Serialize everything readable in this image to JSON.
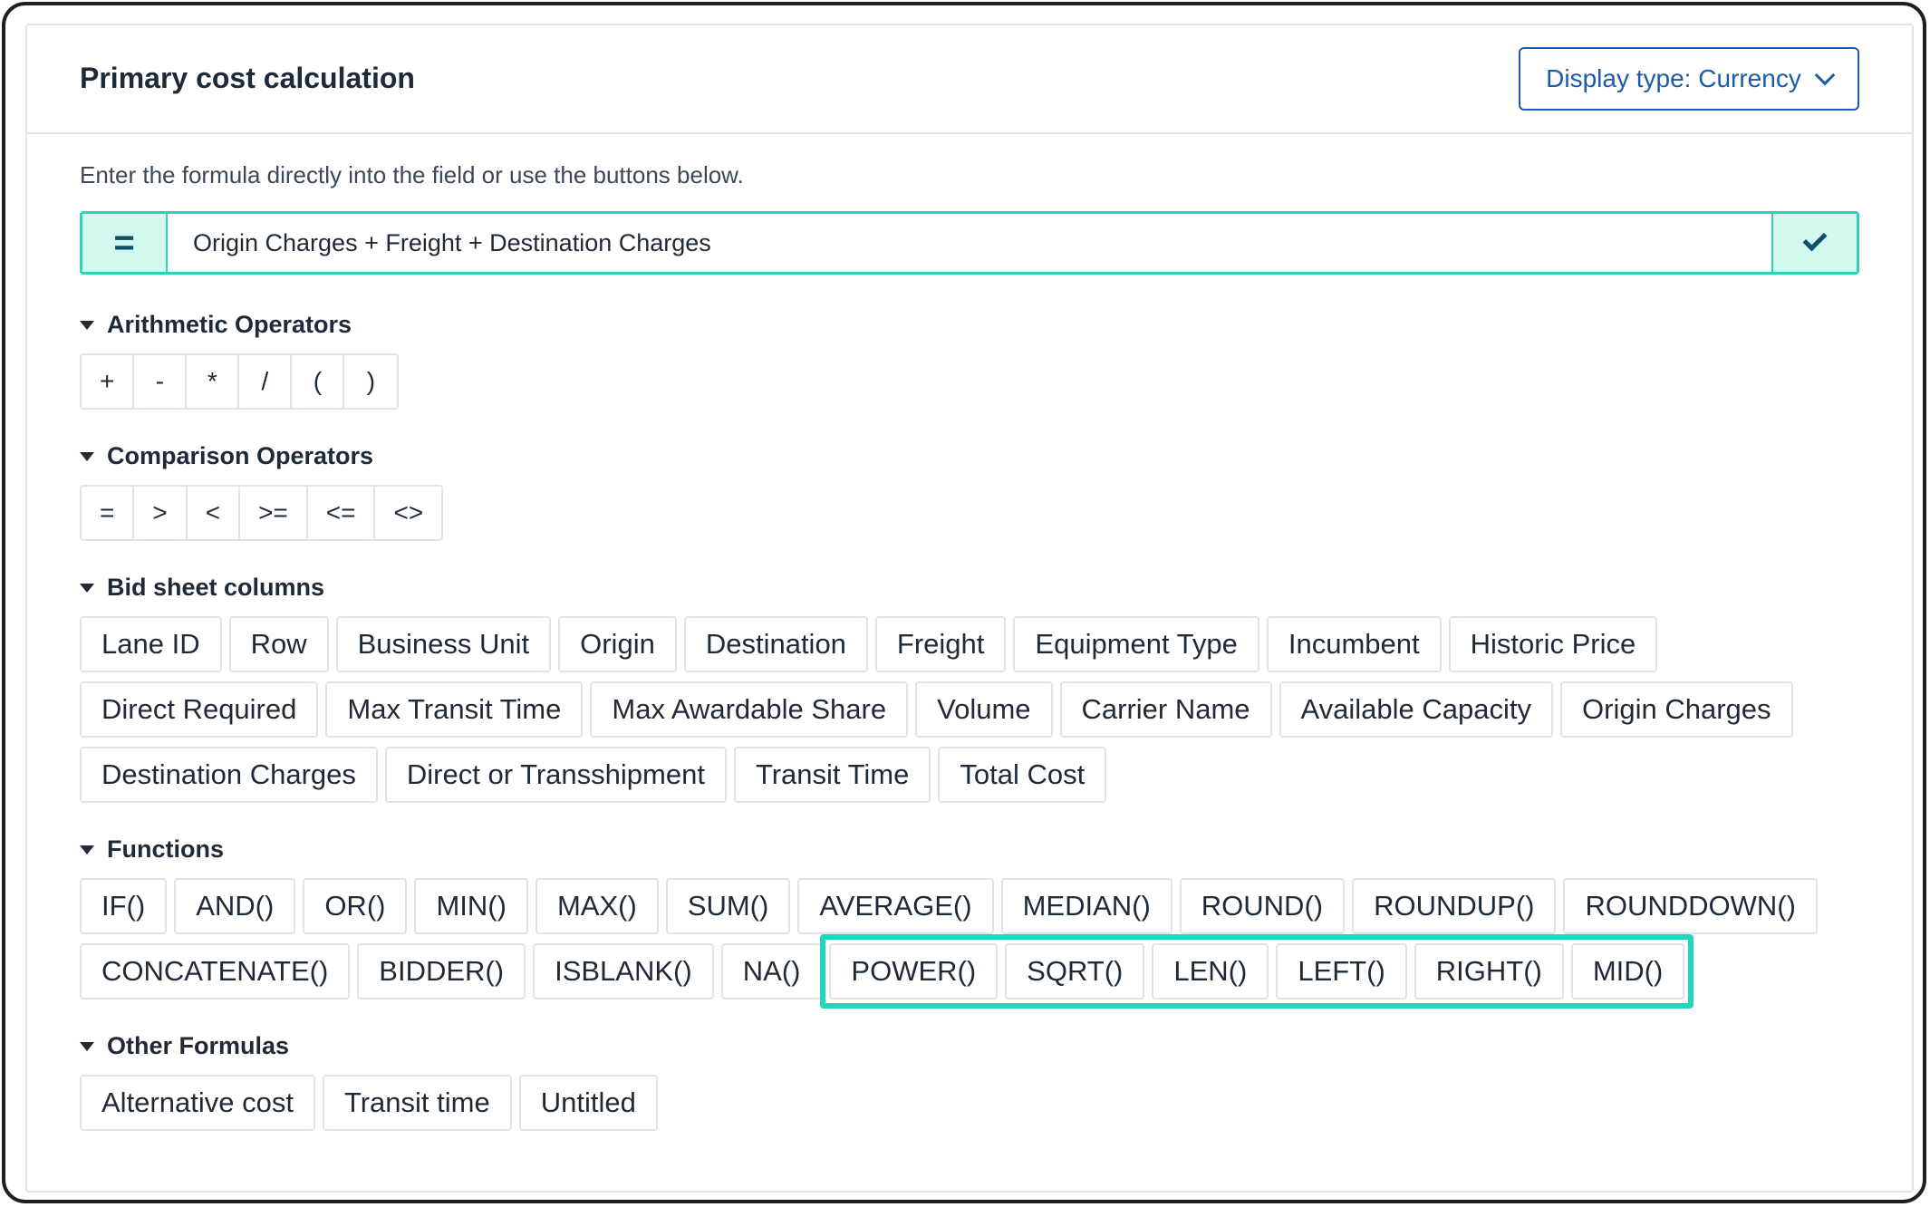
{
  "header": {
    "title": "Primary cost calculation",
    "display_type": "Display type: Currency"
  },
  "formula": {
    "hint": "Enter the formula directly into the field or use the buttons below.",
    "equals_symbol": "=",
    "value": "Origin Charges + Freight + Destination Charges"
  },
  "sections": {
    "arithmetic": {
      "title": "Arithmetic Operators",
      "items": [
        "+",
        "-",
        "*",
        "/",
        "(",
        ")"
      ]
    },
    "comparison": {
      "title": "Comparison Operators",
      "items": [
        "=",
        ">",
        "<",
        ">=",
        "<=",
        "<>"
      ]
    },
    "columns": {
      "title": "Bid sheet columns",
      "items": [
        "Lane ID",
        "Row",
        "Business Unit",
        "Origin",
        "Destination",
        "Freight",
        "Equipment Type",
        "Incumbent",
        "Historic Price",
        "Direct Required",
        "Max Transit Time",
        "Max Awardable Share",
        "Volume",
        "Carrier Name",
        "Available Capacity",
        "Origin Charges",
        "Destination Charges",
        "Direct or Transshipment",
        "Transit Time",
        "Total Cost"
      ]
    },
    "functions": {
      "title": "Functions",
      "items": [
        "IF()",
        "AND()",
        "OR()",
        "MIN()",
        "MAX()",
        "SUM()",
        "AVERAGE()",
        "MEDIAN()",
        "ROUND()",
        "ROUNDUP()",
        "ROUNDDOWN()",
        "CONCATENATE()",
        "BIDDER()",
        "ISBLANK()",
        "NA()",
        "POWER()",
        "SQRT()",
        "LEN()",
        "LEFT()",
        "RIGHT()",
        "MID()"
      ],
      "highlighted": [
        "POWER()",
        "SQRT()",
        "LEN()",
        "LEFT()",
        "RIGHT()",
        "MID()"
      ]
    },
    "other": {
      "title": "Other Formulas",
      "items": [
        "Alternative cost",
        "Transit time",
        "Untitled"
      ]
    }
  },
  "colors": {
    "accent": "#30d0b4",
    "highlight_border": "#20d6bf",
    "link_blue": "#1c5ba8"
  }
}
